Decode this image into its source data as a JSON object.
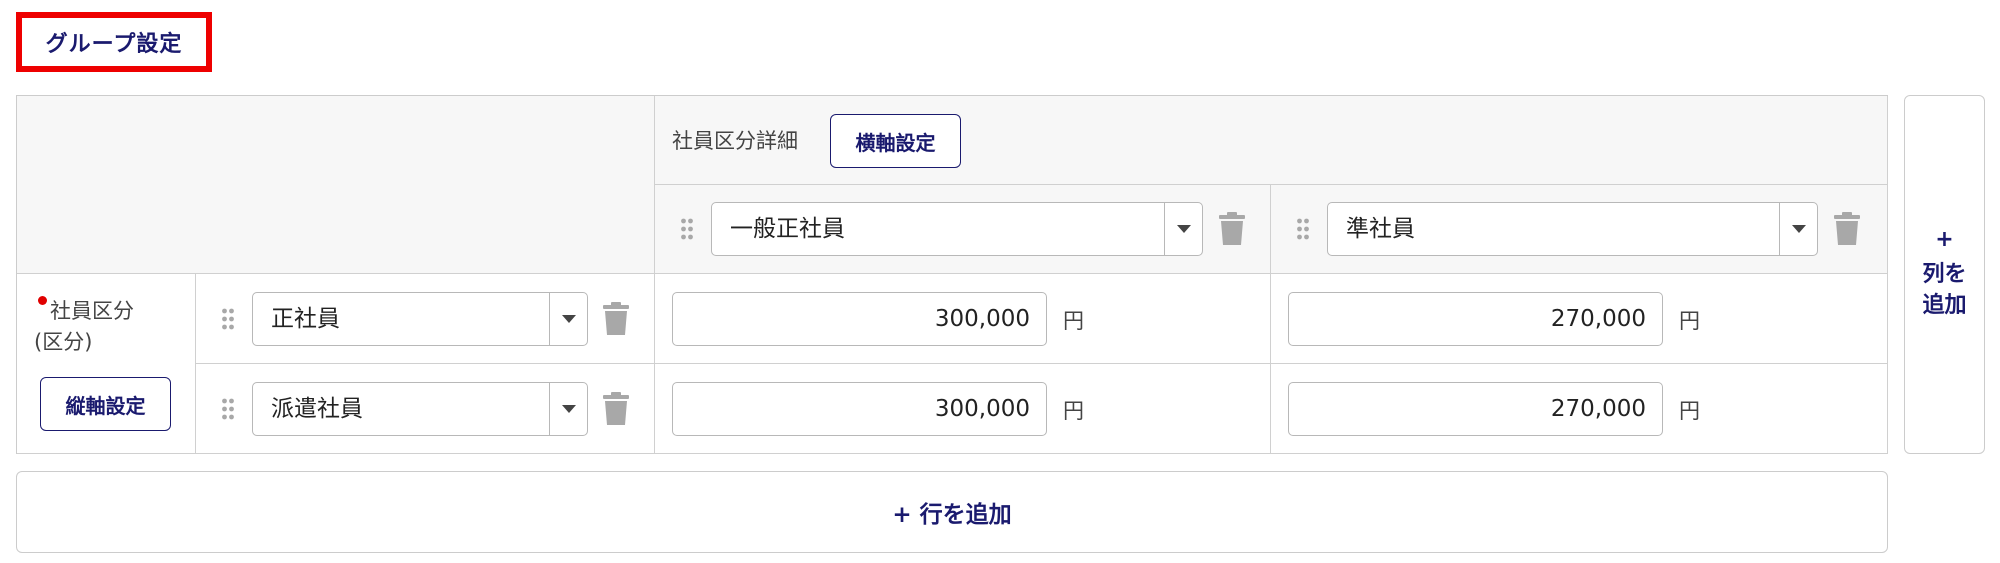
{
  "group_settings_label": "グループ設定",
  "horizontal_axis": {
    "label": "社員区分詳細",
    "settings_button": "横軸設定",
    "columns": [
      {
        "selected": "一般正社員"
      },
      {
        "selected": "準社員"
      }
    ]
  },
  "vertical_axis": {
    "label": "社員区分",
    "sublabel": "(区分)",
    "required": true,
    "settings_button": "縦軸設定",
    "rows": [
      {
        "selected": "正社員",
        "values": [
          "300,000",
          "270,000"
        ]
      },
      {
        "selected": "派遣社員",
        "values": [
          "300,000",
          "270,000"
        ]
      }
    ]
  },
  "currency_unit": "円",
  "add_column": {
    "plus": "+",
    "label_line1": "列を",
    "label_line2": "追加"
  },
  "add_row_label": "+ 行を追加",
  "colors": {
    "accent": "#1a1a6e",
    "highlight_border": "#ee0000",
    "required_dot": "#e00000",
    "icon_gray": "#a8a8a8"
  },
  "icons": {
    "drag": "drag-handle-icon",
    "dropdown": "caret-down-icon",
    "delete": "trash-icon"
  }
}
